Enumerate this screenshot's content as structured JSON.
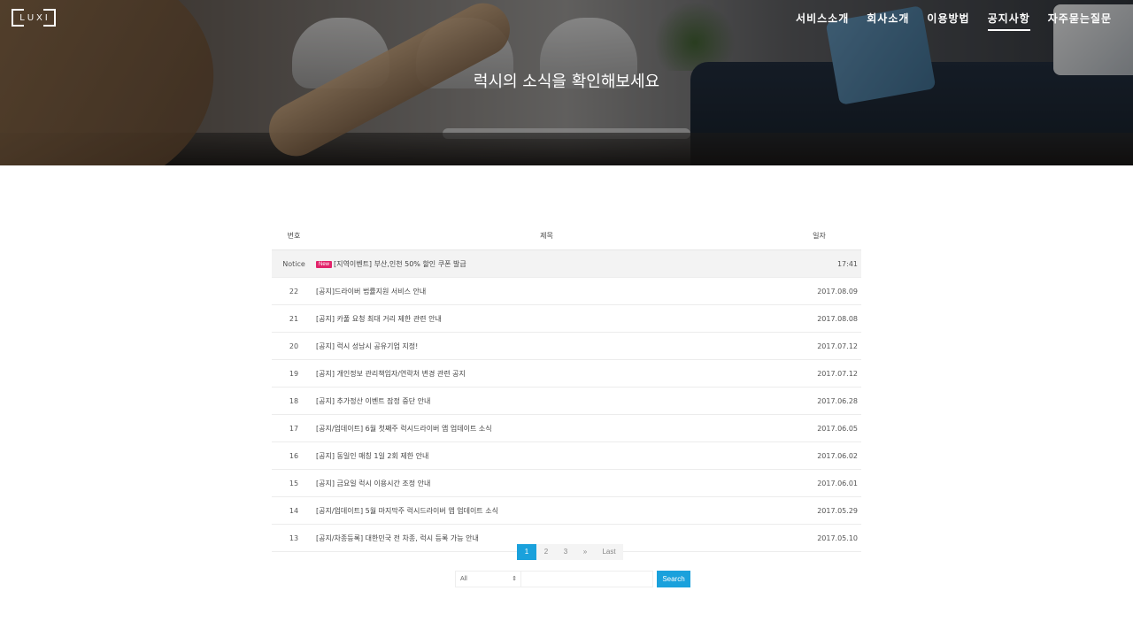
{
  "logo": {
    "text": "LUXI"
  },
  "nav": {
    "items": [
      {
        "label": "서비스소개",
        "active": false
      },
      {
        "label": "회사소개",
        "active": false
      },
      {
        "label": "이용방법",
        "active": false
      },
      {
        "label": "공지사항",
        "active": true
      },
      {
        "label": "자주묻는질문",
        "active": false
      }
    ]
  },
  "hero": {
    "title": "럭시의 소식을 확인해보세요"
  },
  "board": {
    "columns": {
      "num": "번호",
      "title": "제목",
      "date": "일자"
    },
    "notice": {
      "num": "Notice",
      "badge": "New",
      "title": "[지역이벤트] 부산,인천 50% 할인 쿠폰 발급",
      "date": "17:41"
    },
    "rows": [
      {
        "num": "22",
        "title": "[공지]드라이버 법률지원 서비스 안내",
        "date": "2017.08.09"
      },
      {
        "num": "21",
        "title": "[공지] 카풀 요청 최대 거리 제한 관련 안내",
        "date": "2017.08.08"
      },
      {
        "num": "20",
        "title": "[공지] 럭시 성남시 공유기업 지정!",
        "date": "2017.07.12"
      },
      {
        "num": "19",
        "title": "[공지] 개인정보 관리책임자/연락처 변경 관련 공지",
        "date": "2017.07.12"
      },
      {
        "num": "18",
        "title": "[공지] 추가정산 이벤트 잠정 중단 안내",
        "date": "2017.06.28"
      },
      {
        "num": "17",
        "title": "[공지/업데이트] 6월 첫째주 럭시드라이버 앱 업데이트 소식",
        "date": "2017.06.05"
      },
      {
        "num": "16",
        "title": "[공지] 동일인 매칭 1일 2회 제한 안내",
        "date": "2017.06.02"
      },
      {
        "num": "15",
        "title": "[공지] 금요일 럭시 이용시간 조정 안내",
        "date": "2017.06.01"
      },
      {
        "num": "14",
        "title": "[공지/업데이트] 5월 마지막주 럭시드라이버 앱 업데이트 소식",
        "date": "2017.05.29"
      },
      {
        "num": "13",
        "title": "[공지/차종등록] 대한민국 전 차종, 럭시 등록 가능 안내",
        "date": "2017.05.10"
      }
    ]
  },
  "pagination": {
    "pages": [
      "1",
      "2",
      "3"
    ],
    "current": "1",
    "next": "»",
    "last": "Last"
  },
  "search": {
    "select_value": "All",
    "select_arrow": "⇕",
    "input_value": "",
    "button_label": "Search"
  },
  "colors": {
    "accent": "#1aa1dc",
    "new_badge": "#e2246b"
  }
}
